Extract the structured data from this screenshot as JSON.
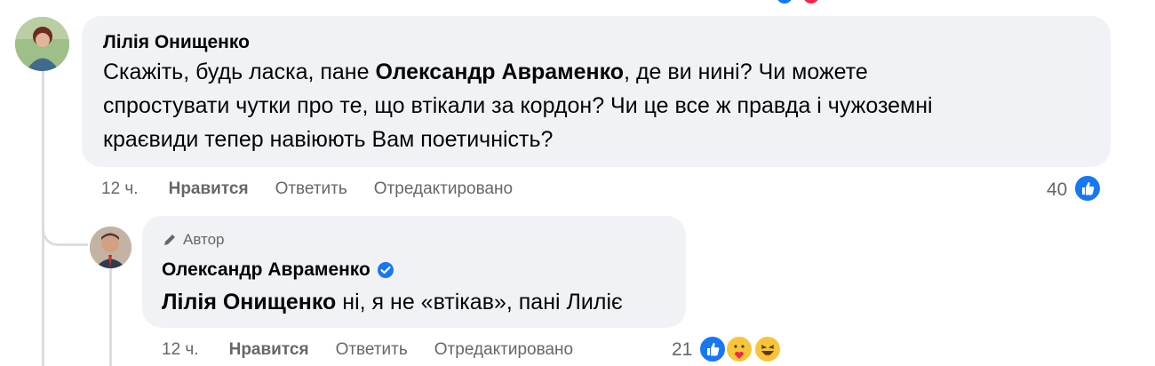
{
  "comment": {
    "author": "Лілія Онищенко",
    "text_before": "Скажіть, будь ласка, пане ",
    "mention": "Олександр Авраменко",
    "text_line1_after": ", де ви нині? Чи можете",
    "text_line2": "спростувати чутки про те, що втікали за кордон? Чи це все ж правда і чужоземні",
    "text_line3": "краєвиди тепер навіюють Вам поетичність?",
    "time": "12 ч.",
    "like_label": "Нравится",
    "reply_label": "Ответить",
    "edited_label": "Отредактировано",
    "reaction_count": "40",
    "reaction_icon": "like-icon"
  },
  "reply": {
    "badge": "Автор",
    "badge_icon": "pen-icon",
    "author": "Олександр Авраменко",
    "verified_icon": "verified-badge-icon",
    "mention": "Лілія Онищенко",
    "text": " ні, я не «втікав», пані Лиліє",
    "time": "12 ч.",
    "like_label": "Нравится",
    "reply_label": "Ответить",
    "edited_label": "Отредактировано",
    "reaction_count": "21",
    "reaction_icons": [
      "like-icon",
      "care-icon",
      "haha-icon"
    ]
  },
  "colors": {
    "bubble": "#f0f2f5",
    "meta": "#65676b",
    "accent": "#1877f2"
  }
}
